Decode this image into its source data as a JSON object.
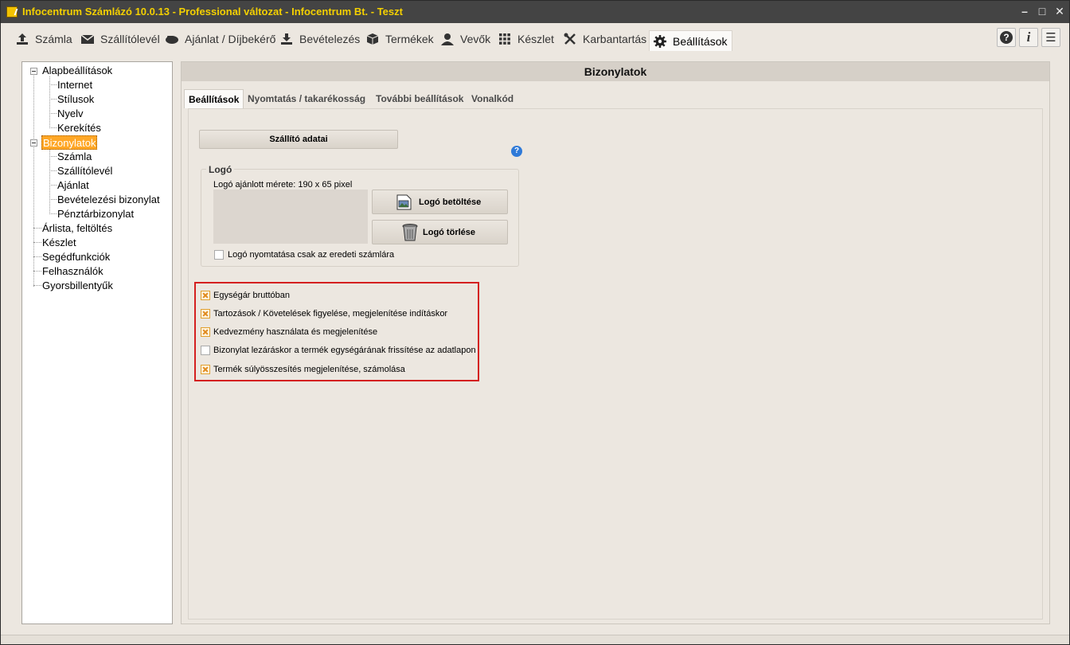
{
  "window": {
    "title": "Infocentrum Számlázó 10.0.13 - Professional változat - Infocentrum Bt. - Teszt",
    "controls": {
      "minimize": "–",
      "maximize": "□",
      "close": "✕"
    }
  },
  "menubar": {
    "items": [
      {
        "label": "Számla",
        "icon": "upload-icon"
      },
      {
        "label": "Szállítólevél",
        "icon": "envelope-icon"
      },
      {
        "label": "Ajánlat / Díjbekérő",
        "icon": "hand-icon"
      },
      {
        "label": "Bevételezés",
        "icon": "download-icon"
      },
      {
        "label": "Termékek",
        "icon": "box-icon"
      },
      {
        "label": "Vevők",
        "icon": "person-icon"
      },
      {
        "label": "Készlet",
        "icon": "grid-icon"
      },
      {
        "label": "Karbantartás",
        "icon": "tools-icon"
      },
      {
        "label": "Beállítások",
        "icon": "gear-icon",
        "active": true
      }
    ],
    "right_buttons": [
      {
        "icon": "help-icon",
        "glyph": "?"
      },
      {
        "icon": "info-icon",
        "glyph": "i"
      },
      {
        "icon": "list-icon",
        "glyph": "☰"
      }
    ]
  },
  "tree": {
    "groups": [
      {
        "label": "Alapbeállítások",
        "expanded": true,
        "children": [
          "Internet",
          "Stílusok",
          "Nyelv",
          "Kerekítés"
        ]
      },
      {
        "label": "Bizonylatok",
        "expanded": true,
        "selected": true,
        "children": [
          "Számla",
          "Szállítólevél",
          "Ajánlat",
          "Bevételezési bizonylat",
          "Pénztárbizonylat"
        ]
      }
    ],
    "items": [
      "Árlista, feltöltés",
      "Készlet",
      "Segédfunkciók",
      "Felhasználók",
      "Gyorsbillentyűk"
    ]
  },
  "main": {
    "header": "Bizonylatok",
    "tabs": [
      {
        "label": "Beállítások",
        "active": true
      },
      {
        "label": "Nyomtatás / takarékosság"
      },
      {
        "label": "További beállítások"
      },
      {
        "label": "Vonalkód"
      }
    ],
    "supplier_button": "Szállító adatai",
    "help_glyph": "?",
    "logo_group": {
      "title": "Logó",
      "size_hint": "Logó ajánlott mérete: 190 x 65 pixel",
      "load_button": "Logó betöltése",
      "delete_button": "Logó törlése",
      "print_only_original": {
        "label": "Logó nyomtatása csak az eredeti számlára",
        "checked": false
      }
    },
    "options": [
      {
        "label": "Egységár bruttóban",
        "checked": true
      },
      {
        "label": "Tartozások / Követelések figyelése, megjelenítése indításkor",
        "checked": true
      },
      {
        "label": "Kedvezmény használata és megjelenítése",
        "checked": true
      },
      {
        "label": "Bizonylat lezáráskor a termék egységárának frissítése az adatlapon",
        "checked": false
      },
      {
        "label": "Termék súlyösszesítés megjelenítése, számolása",
        "checked": true
      }
    ]
  },
  "colors": {
    "accent_orange": "#ffa726",
    "title_yellow": "#f4d000",
    "highlight_red": "#d42020",
    "help_blue": "#2f7ad8"
  }
}
